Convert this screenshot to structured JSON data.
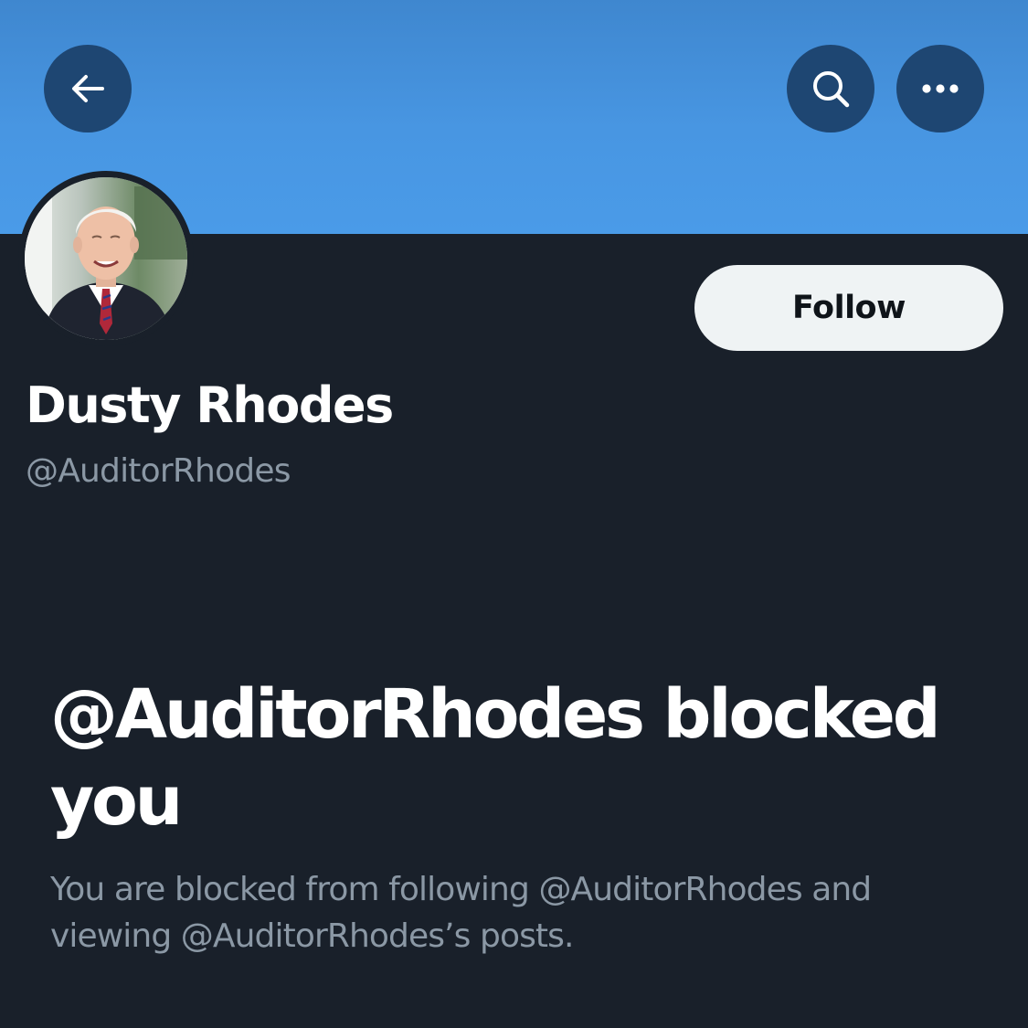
{
  "header": {
    "back_icon": "arrow-left-icon",
    "search_icon": "search-icon",
    "more_icon": "more-horizontal-icon",
    "banner_color": "#4a9be8",
    "button_color": "#1e4672"
  },
  "profile": {
    "display_name": "Dusty Rhodes",
    "handle": "@AuditorRhodes",
    "follow_label": "Follow"
  },
  "blocked": {
    "title": "@AuditorRhodes blocked you",
    "description": "You are blocked from following @AuditorRhodes and viewing @AuditorRhodes’s posts."
  },
  "colors": {
    "background": "#19202a",
    "primary_text": "#ffffff",
    "secondary_text": "#8b98a5",
    "follow_bg": "#eff3f4"
  }
}
